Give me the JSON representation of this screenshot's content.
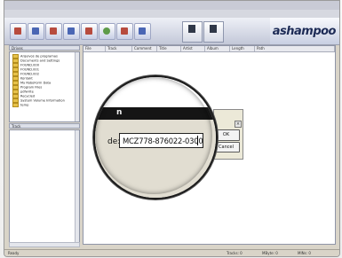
{
  "app": {
    "logo": "ashampoo"
  },
  "menubar": {
    "items": [
      "",
      "",
      "",
      "",
      "",
      ""
    ]
  },
  "toolbar": {
    "big_buttons": [
      "",
      ""
    ]
  },
  "left_pane": {
    "tree_header": "Drives",
    "tree_items": [
      "Arquivos de programas",
      "Documents and Settings",
      "FOUND.000",
      "FOUND.001",
      "FOUND.002",
      "Kontakt",
      "My RoboForm Data",
      "Program Files",
      "pdfwrite",
      "Recycled",
      "System Volume Information",
      "temp"
    ],
    "track_header": "Track"
  },
  "right_pane": {
    "columns": [
      "File",
      "Track",
      "Comment",
      "Title",
      "Artist",
      "Album",
      "Length",
      "Path"
    ]
  },
  "dialog": {
    "title_fragment": "n",
    "field_label": "de:",
    "field_value": "MCZ778-876022-0300",
    "ok_label": "OK",
    "cancel_label": "Cancel",
    "close_label": "×"
  },
  "status": {
    "left": "Ready",
    "tracks": "Tracks: 0",
    "mbytes": "MByte: 0",
    "mins": "MINs: 0"
  }
}
